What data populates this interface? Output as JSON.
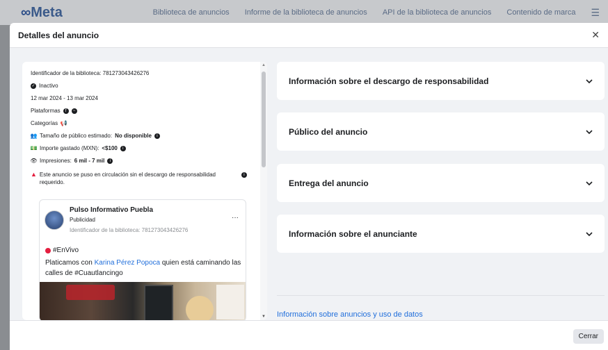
{
  "nav": {
    "logo_text": "Meta",
    "links": [
      "Biblioteca de anuncios",
      "Informe de la biblioteca de anuncios",
      "API de la biblioteca de anuncios",
      "Contenido de marca"
    ]
  },
  "modal": {
    "title": "Detalles del anuncio",
    "close_label": "Cerrar"
  },
  "details": {
    "library_id": "Identificador de la biblioteca: 781273043426276",
    "status": "Inactivo",
    "date_range": "12 mar 2024 - 13 mar 2024",
    "platforms_label": "Plataformas",
    "categories_label": "Categorías",
    "audience_label": "Tamaño de público estimado:",
    "audience_value": "No disponible",
    "spend_label": "Importe gastado (MXN):",
    "spend_value": "<$100",
    "impressions_label": "Impresiones:",
    "impressions_value": "6 mil - 7 mil",
    "warning_text": "Este anuncio se puso en circulación sin el descargo de responsabilidad requerido."
  },
  "ad": {
    "page_name": "Pulso Informativo Puebla",
    "sponsored": "Publicidad",
    "library_id": "Identificador de la biblioteca: 781273043426276",
    "more": "···",
    "live_tag": "#EnVivo",
    "body_prefix": "Platicamos con ",
    "body_link": "Karina Pérez Popoca",
    "body_suffix": " quien está caminando las calles de #Cuautlancingo"
  },
  "sections": [
    {
      "title": "Información sobre el descargo de responsabilidad"
    },
    {
      "title": "Público del anuncio"
    },
    {
      "title": "Entrega del anuncio"
    },
    {
      "title": "Información sobre el anunciante"
    }
  ],
  "privacy_link": "Información sobre anuncios y uso de datos",
  "colors": {
    "accent": "#216fdb",
    "warning": "#e41e3f",
    "body_bg": "#f0f2f5"
  }
}
